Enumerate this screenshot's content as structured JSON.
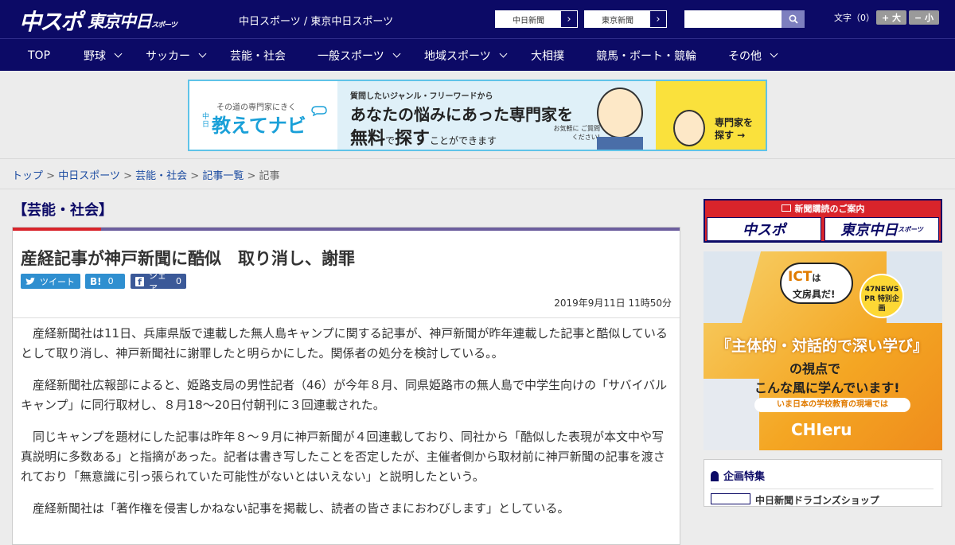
{
  "header": {
    "logo_main": "中スポ",
    "logo_sub": "東京中日",
    "logo_sub_small": "スポーツ",
    "site_line": "中日スポーツ / 東京中日スポーツ",
    "paper_links": [
      {
        "label": "中日新聞"
      },
      {
        "label": "東京新聞"
      }
    ],
    "search_placeholder": "",
    "font_label": "文字（0）",
    "font_bigger": "+ 大",
    "font_smaller": "− 小"
  },
  "nav": [
    {
      "label": "TOP",
      "has_sub": false
    },
    {
      "label": "野球",
      "has_sub": true
    },
    {
      "label": "サッカー",
      "has_sub": true
    },
    {
      "label": "芸能・社会",
      "has_sub": false
    },
    {
      "label": "一般スポーツ",
      "has_sub": true
    },
    {
      "label": "地域スポーツ",
      "has_sub": true
    },
    {
      "label": "大相撲",
      "has_sub": false
    },
    {
      "label": "競馬・ボート・競輪",
      "has_sub": false
    },
    {
      "label": "その他",
      "has_sub": true
    }
  ],
  "ad_banner": {
    "left_sub": "その道の専門家にきく",
    "left_prefix": "中日",
    "left_main": "教えてナビ",
    "mid_line1": "質問したいジャンル・フリーワードから",
    "mid_line2": "あなたの悩みにあった専門家を",
    "mid_line3_a": "無料",
    "mid_line3_b": "で",
    "mid_line3_c": "探す",
    "mid_line3_d": "ことができます",
    "mid_note": "お気軽に ご質問ください!",
    "right_cta": "専門家を 探す →"
  },
  "breadcrumb": [
    {
      "label": "トップ",
      "link": true
    },
    {
      "label": "中日スポーツ",
      "link": true
    },
    {
      "label": "芸能・社会",
      "link": true
    },
    {
      "label": "記事一覧",
      "link": true
    },
    {
      "label": "記事",
      "link": false
    }
  ],
  "breadcrumb_sep": ">",
  "category": "【芸能・社会】",
  "article": {
    "title": "産経記事が神戸新聞に酷似　取り消し、謝罪",
    "share": {
      "tweet": "ツイート",
      "hatena_label": "B!",
      "hatena_count": "0",
      "facebook": "シェア",
      "facebook_count": "0"
    },
    "date": "2019年9月11日 11時50分",
    "paragraphs": [
      "産経新聞社は11日、兵庫県版で連載した無人島キャンプに関する記事が、神戸新聞が昨年連載した記事と酷似しているとして取り消し、神戸新聞社に謝罪したと明らかにした。関係者の処分を検討している。。",
      "産経新聞社広報部によると、姫路支局の男性記者（46）が今年８月、同県姫路市の無人島で中学生向けの「サバイバルキャンプ」に同行取材し、８月18～20日付朝刊に３回連載された。",
      "同じキャンプを題材にした記事は昨年８～９月に神戸新聞が４回連載しており、同社から「酷似した表現が本文中や写真説明に多数ある」と指摘があった。記者は書き写したことを否定したが、主催者側から取材前に神戸新聞の記事を渡されており「無意識に引っ張られていた可能性がないとはいえない」と説明したという。",
      "産経新聞社は「著作権を侵害しかねない記事を掲載し、読者の皆さまにおわびします」としている。"
    ]
  },
  "sidebar": {
    "subscribe_header": "新聞購読のご案内",
    "subscribe_a": "中スポ",
    "subscribe_b": "東京中日",
    "subscribe_b_small": "スポーツ",
    "ad2": {
      "ict_a": "ICT",
      "ict_b": "は",
      "ict_c": "文房具だ!",
      "badge": "47NEWS PR 特別企画",
      "headline_a": "『主体的・対話的で深い学び』",
      "headline_b": "の視点で",
      "headline_c": "こんな風に学んでいます!",
      "ribbon": "いま日本の学校教育の現場では",
      "brand": "CHIeru"
    },
    "feature_title": "企画特集",
    "feature_item": "中日新聞ドラゴンズショップ"
  },
  "colors": {
    "brand_navy": "#0c0a66",
    "accent_red": "#d9242b",
    "accent_purple": "#6d5f9e",
    "share_blue": "#2f8fd0"
  }
}
